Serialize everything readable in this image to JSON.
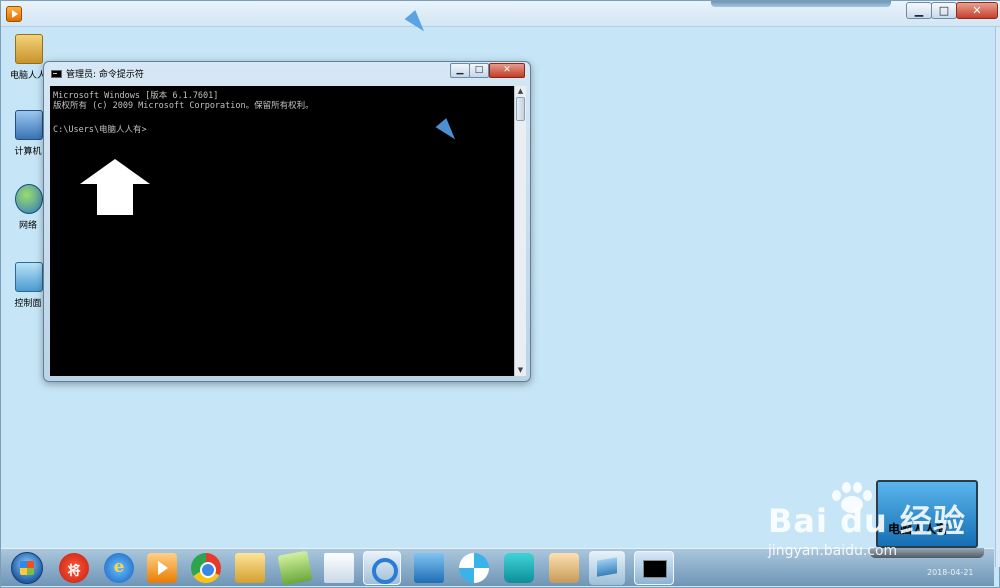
{
  "cmd_window": {
    "title": "管理员: 命令提示符",
    "controls": {
      "minimize": "▁",
      "maximize": "□",
      "close": "✕"
    },
    "console_lines": [
      "Microsoft Windows [版本 6.1.7601]",
      "版权所有 (c) 2009 Microsoft Corporation。保留所有权利。"
    ],
    "prompt": "C:\\Users\\电脑人人有>",
    "scroll": {
      "up": "▲",
      "down": "▼"
    }
  },
  "outer_window": {
    "controls": {
      "minimize": "▁",
      "maximize": "□",
      "close": "✕"
    }
  },
  "desktop_icons": [
    {
      "label": "电脑人人",
      "icon": "user-folder-icon"
    },
    {
      "label": "计算机",
      "icon": "computer-icon"
    },
    {
      "label": "网络",
      "icon": "network-globe-icon"
    },
    {
      "label": "控制面",
      "icon": "control-panel-icon"
    }
  ],
  "taskbar": {
    "jiang_glyph": "将",
    "ie_glyph": "e"
  },
  "overlay": {
    "thumbnail_text": "电脑人人有",
    "watermark_brand": "Bai du 经验",
    "watermark_url": "jingyan.baidu.com",
    "date": "2018-04-21"
  },
  "colors": {
    "desktop": "#c5e4f5",
    "console_bg": "#000000",
    "console_text": "#c0c0c0"
  }
}
